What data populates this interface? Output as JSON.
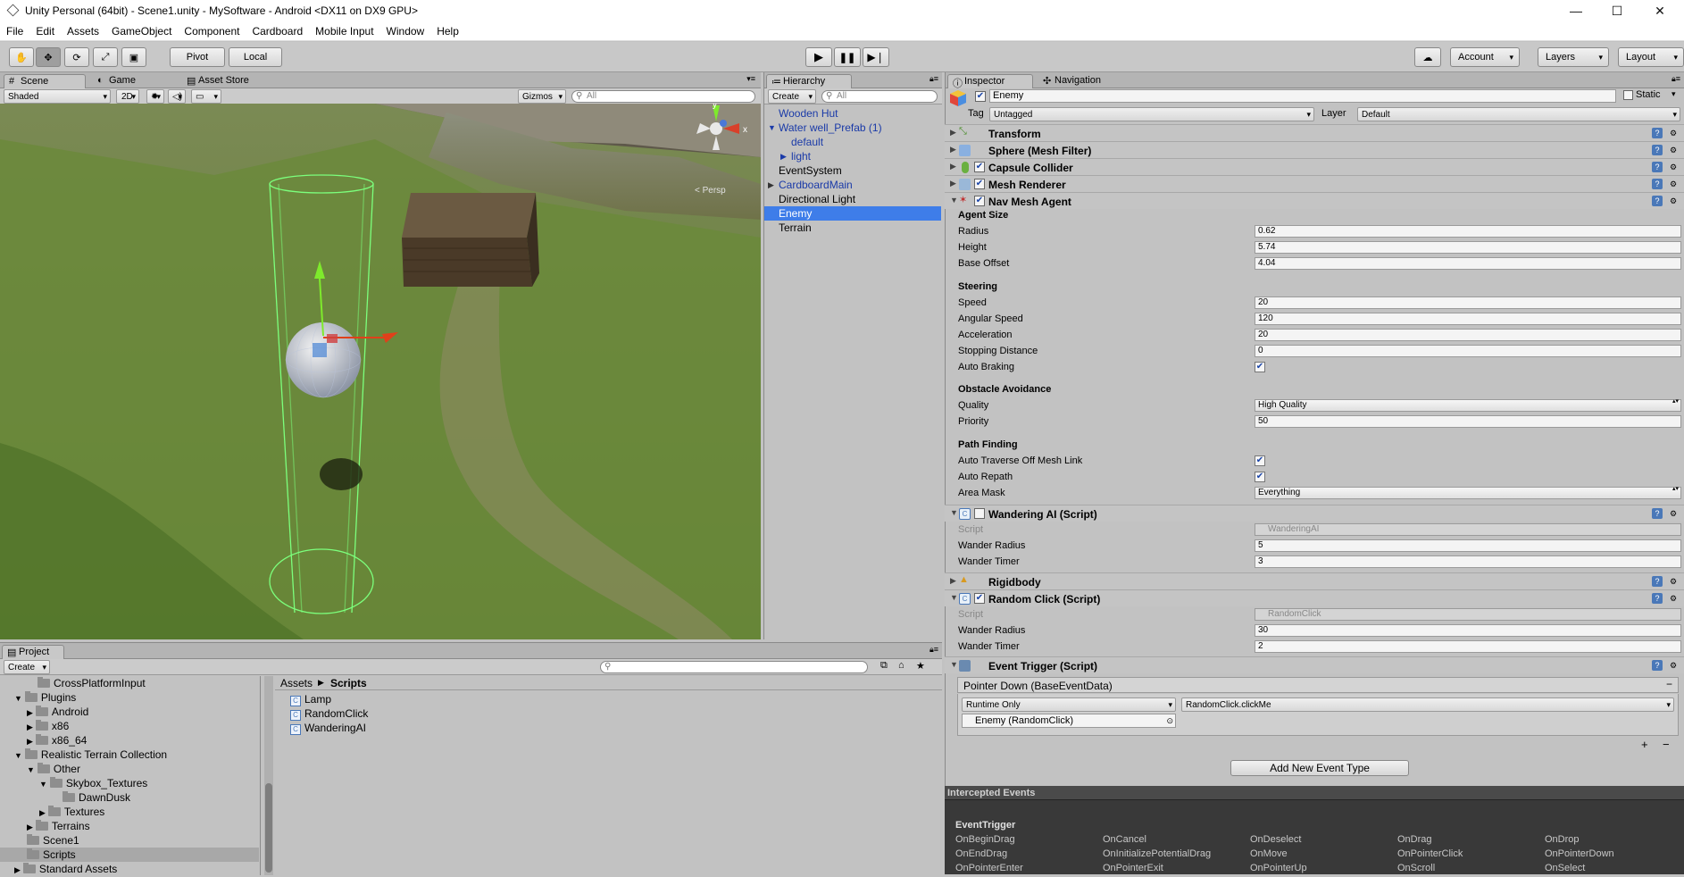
{
  "window": {
    "title": "Unity Personal (64bit) - Scene1.unity - MySoftware - Android <DX11 on DX9 GPU>"
  },
  "menu": [
    "File",
    "Edit",
    "Assets",
    "GameObject",
    "Component",
    "Cardboard",
    "Mobile Input",
    "Window",
    "Help"
  ],
  "toolbar": {
    "pivot": "Pivot",
    "local": "Local",
    "account": "Account",
    "layers": "Layers",
    "layout": "Layout"
  },
  "scene_tabs": {
    "scene": "Scene",
    "game": "Game",
    "asset_store": "Asset Store"
  },
  "scene_bar": {
    "shading": "Shaded",
    "mode2d": "2D",
    "gizmos": "Gizmos",
    "search_placeholder": "All"
  },
  "gizmo": {
    "y": "y",
    "x": "x",
    "persp": "< Persp"
  },
  "hierarchy": {
    "tab": "Hierarchy",
    "create": "Create",
    "search_placeholder": "All",
    "items": [
      {
        "label": "Wooden Hut"
      },
      {
        "label": "Water well_Prefab (1)"
      },
      {
        "label": "default"
      },
      {
        "label": "light"
      },
      {
        "label": "EventSystem"
      },
      {
        "label": "CardboardMain"
      },
      {
        "label": "Directional Light"
      },
      {
        "label": "Enemy"
      },
      {
        "label": "Terrain"
      }
    ]
  },
  "inspector": {
    "tab": "Inspector",
    "nav_tab": "Navigation",
    "object_name": "Enemy",
    "static_label": "Static",
    "tag_label": "Tag",
    "tag_value": "Untagged",
    "layer_label": "Layer",
    "layer_value": "Default",
    "components": {
      "transform": "Transform",
      "mesh_filter": "Sphere (Mesh Filter)",
      "capsule_collider": "Capsule Collider",
      "mesh_renderer": "Mesh Renderer",
      "nav_mesh_agent": "Nav Mesh Agent",
      "wandering_ai": "Wandering AI (Script)",
      "rigidbody": "Rigidbody",
      "random_click": "Random Click (Script)",
      "event_trigger": "Event Trigger (Script)"
    },
    "nav": {
      "agent_size": "Agent Size",
      "radius_label": "Radius",
      "radius": "0.62",
      "height_label": "Height",
      "height": "5.74",
      "base_offset_label": "Base Offset",
      "base_offset": "4.04",
      "steering": "Steering",
      "speed_label": "Speed",
      "speed": "20",
      "angular_speed_label": "Angular Speed",
      "angular_speed": "120",
      "acceleration_label": "Acceleration",
      "acceleration": "20",
      "stopping_distance_label": "Stopping Distance",
      "stopping_distance": "0",
      "auto_braking_label": "Auto Braking",
      "obstacle_avoidance": "Obstacle Avoidance",
      "quality_label": "Quality",
      "quality": "High Quality",
      "priority_label": "Priority",
      "priority": "50",
      "path_finding": "Path Finding",
      "auto_traverse_label": "Auto Traverse Off Mesh Link",
      "auto_repath_label": "Auto Repath",
      "area_mask_label": "Area Mask",
      "area_mask": "Everything"
    },
    "wandering": {
      "script_label": "Script",
      "script": "WanderingAI",
      "radius_label": "Wander Radius",
      "radius": "5",
      "timer_label": "Wander Timer",
      "timer": "3"
    },
    "random_click": {
      "script_label": "Script",
      "script": "RandomClick",
      "radius_label": "Wander Radius",
      "radius": "30",
      "timer_label": "Wander Timer",
      "timer": "2"
    },
    "event_trigger": {
      "entry": "Pointer Down (BaseEventData)",
      "runtime": "Runtime Only",
      "function": "RandomClick.clickMe",
      "target": "Enemy (RandomClick)",
      "add_button": "Add New Event Type"
    },
    "intercepted": {
      "title": "Intercepted Events",
      "subtitle": "EventTrigger",
      "events": [
        "OnBeginDrag",
        "OnCancel",
        "OnDeselect",
        "OnDrag",
        "OnDrop",
        "OnEndDrag",
        "OnInitializePotentialDrag",
        "OnMove",
        "OnPointerClick",
        "OnPointerDown",
        "OnPointerEnter",
        "OnPointerExit",
        "OnPointerUp",
        "OnScroll",
        "OnSelect"
      ]
    }
  },
  "project": {
    "tab": "Project",
    "create": "Create",
    "tree": [
      {
        "label": "CrossPlatformInput"
      },
      {
        "label": "Plugins"
      },
      {
        "label": "Android"
      },
      {
        "label": "x86"
      },
      {
        "label": "x86_64"
      },
      {
        "label": "Realistic Terrain Collection"
      },
      {
        "label": "Other"
      },
      {
        "label": "Skybox_Textures"
      },
      {
        "label": "DawnDusk"
      },
      {
        "label": "Textures"
      },
      {
        "label": "Terrains"
      },
      {
        "label": "Scene1"
      },
      {
        "label": "Scripts"
      },
      {
        "label": "Standard Assets"
      }
    ],
    "breadcrumb": {
      "root": "Assets",
      "current": "Scripts"
    },
    "files": [
      "Lamp",
      "RandomClick",
      "WanderingAI"
    ]
  },
  "colors": {
    "selection": "#3e7de9",
    "link": "#1a3aa8",
    "panel": "#c2c2c2",
    "dark_panel": "#393939"
  }
}
